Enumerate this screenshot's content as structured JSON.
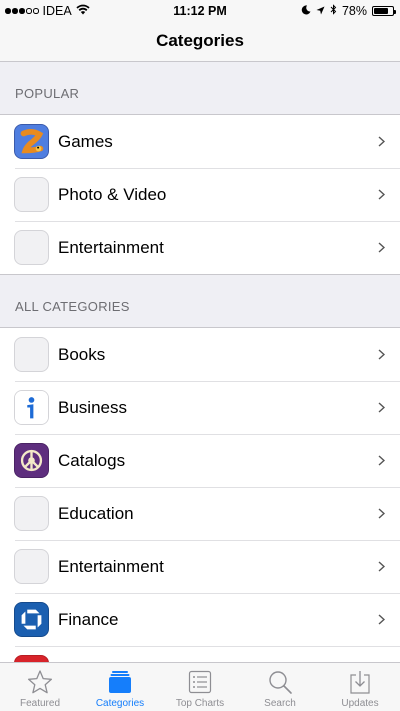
{
  "status_bar": {
    "carrier": "IDEA",
    "time": "11:12 PM",
    "battery_percent": "78%",
    "battery_level": 0.78
  },
  "nav": {
    "title": "Categories"
  },
  "sections": {
    "popular": {
      "header": "POPULAR",
      "items": [
        {
          "label": "Games",
          "icon": "games-app-icon"
        },
        {
          "label": "Photo & Video",
          "icon": "placeholder-icon"
        },
        {
          "label": "Entertainment",
          "icon": "placeholder-icon"
        }
      ]
    },
    "all": {
      "header": "ALL CATEGORIES",
      "items": [
        {
          "label": "Books",
          "icon": "placeholder-icon"
        },
        {
          "label": "Business",
          "icon": "business-app-icon"
        },
        {
          "label": "Catalogs",
          "icon": "catalogs-app-icon"
        },
        {
          "label": "Education",
          "icon": "placeholder-icon"
        },
        {
          "label": "Entertainment",
          "icon": "placeholder-icon"
        },
        {
          "label": "Finance",
          "icon": "finance-app-icon"
        }
      ]
    }
  },
  "tabs": [
    {
      "label": "Featured",
      "icon": "star-icon",
      "active": false
    },
    {
      "label": "Categories",
      "icon": "categories-icon",
      "active": true
    },
    {
      "label": "Top Charts",
      "icon": "list-icon",
      "active": false
    },
    {
      "label": "Search",
      "icon": "search-icon",
      "active": false
    },
    {
      "label": "Updates",
      "icon": "download-icon",
      "active": false
    }
  ],
  "colors": {
    "accent": "#157efb",
    "inactive": "#8e8e93",
    "background": "#efeff4"
  }
}
